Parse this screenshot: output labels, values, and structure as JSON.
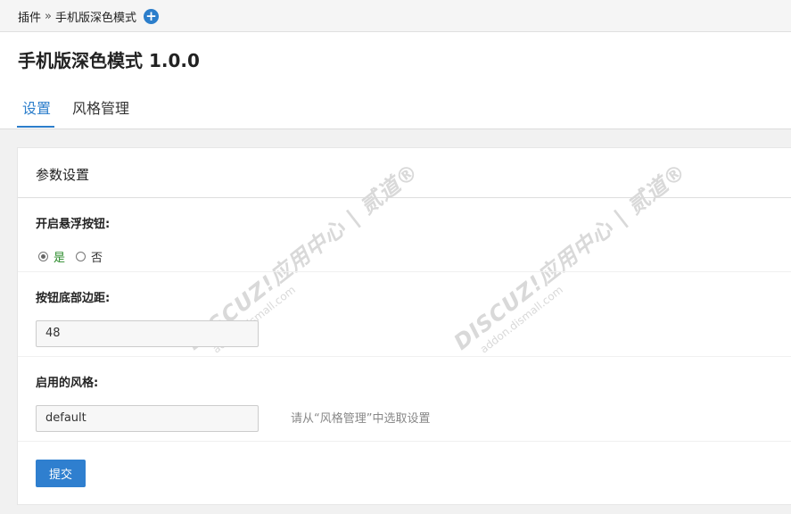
{
  "breadcrumb": {
    "root": "插件",
    "separator": "»",
    "current": "手机版深色模式",
    "add_icon": "plus-circle-icon"
  },
  "page": {
    "title": "手机版深色模式 1.0.0"
  },
  "tabs": [
    {
      "label": "设置",
      "active": true
    },
    {
      "label": "风格管理",
      "active": false
    }
  ],
  "card": {
    "title": "参数设置"
  },
  "fields": {
    "float_button": {
      "label": "开启悬浮按钮:",
      "options": [
        "是",
        "否"
      ],
      "selected": "是"
    },
    "bottom_margin": {
      "label": "按钮底部边距:",
      "value": "48"
    },
    "style": {
      "label": "启用的风格:",
      "value": "default",
      "hint": "请从“风格管理”中选取设置"
    }
  },
  "submit_label": "提交",
  "watermark": {
    "brand": "DISCUZ!应用中心 | 贰道®",
    "url": "addon.dismall.com"
  },
  "colors": {
    "accent": "#2c7ecb",
    "yes_option": "#2a8a2a"
  }
}
